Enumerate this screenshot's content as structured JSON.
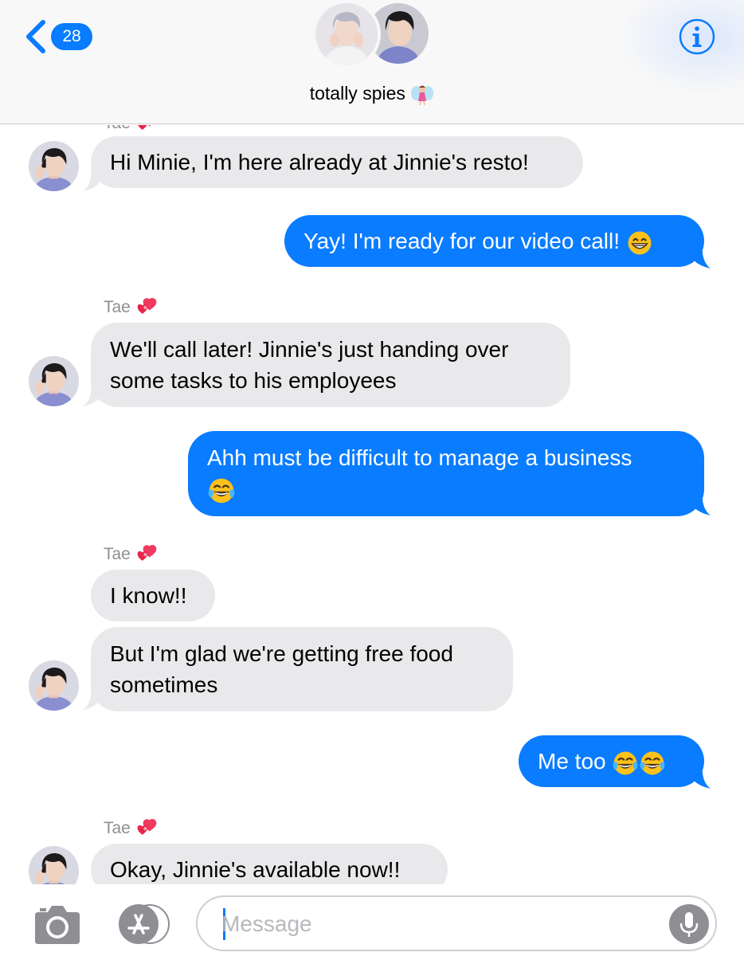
{
  "header": {
    "back_count": "28",
    "title": "totally spies",
    "title_emoji": "fairy"
  },
  "composer": {
    "placeholder": "Message"
  },
  "messages": [
    {
      "from": "Tae",
      "direction": "incoming",
      "text": "Hi Minie, I'm here already at Jinnie's resto!"
    },
    {
      "direction": "outgoing",
      "text": "Yay! I'm ready for our video call!",
      "emoji": "grinning-face"
    },
    {
      "from": "Tae",
      "direction": "incoming",
      "sender_label": "Tae",
      "sender_emoji": "two-hearts",
      "text_line1": "We'll call later! Jinnie's just handing over",
      "text_line2": "some tasks to his employees"
    },
    {
      "direction": "outgoing",
      "text": "Ahh must be difficult to manage a business",
      "emoji": "tears-of-joy"
    },
    {
      "from": "Tae",
      "direction": "incoming",
      "sender_label": "Tae",
      "sender_emoji": "two-hearts",
      "text": "I know!!"
    },
    {
      "from": "Tae",
      "direction": "incoming",
      "text_line1": "But I'm glad we're getting free food",
      "text_line2": "sometimes"
    },
    {
      "direction": "outgoing",
      "text": "Me too",
      "emoji": "tears-of-joy x2"
    },
    {
      "from": "Tae",
      "direction": "incoming",
      "sender_label": "Tae",
      "sender_emoji": "two-hearts",
      "text": "Okay, Jinnie's available now!!"
    }
  ],
  "colors": {
    "outgoing_bubble": "#0a7cff",
    "incoming_bubble": "#e9e9eb",
    "accent": "#0a7cff",
    "secondary_text": "#8e8e93"
  },
  "icons": [
    "back-chevron-icon",
    "info-icon",
    "camera-icon",
    "app-store-icon",
    "microphone-icon",
    "fairy-emoji",
    "two-hearts-emoji",
    "grinning-face-emoji",
    "tears-of-joy-emoji"
  ]
}
